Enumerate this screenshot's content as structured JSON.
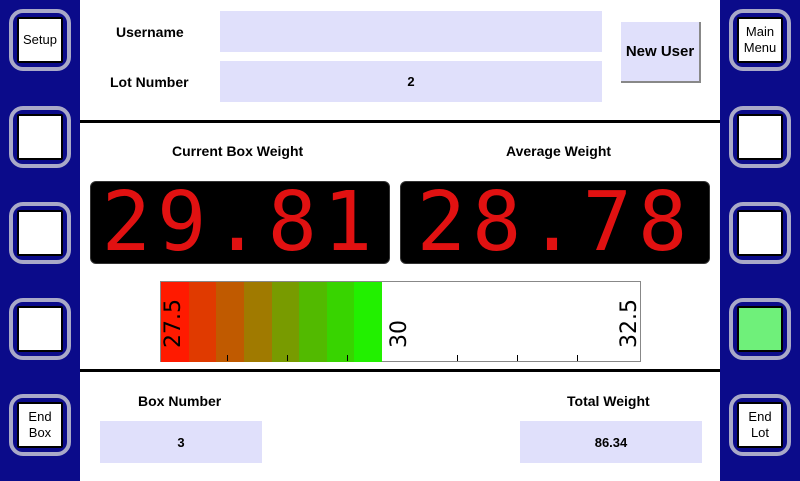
{
  "left_buttons": [
    {
      "label": "Setup"
    },
    {
      "label": ""
    },
    {
      "label": ""
    },
    {
      "label": ""
    },
    {
      "label": "End\nBox"
    }
  ],
  "right_buttons": [
    {
      "label": "Main\nMenu"
    },
    {
      "label": ""
    },
    {
      "label": ""
    },
    {
      "label": "",
      "indicator": "green"
    },
    {
      "label": "End\nLot"
    }
  ],
  "header": {
    "username_label": "Username",
    "username_value": "",
    "lot_label": "Lot Number",
    "lot_value": "2",
    "new_user_button": "New User"
  },
  "weights": {
    "current_label": "Current Box Weight",
    "current_value": "29.81",
    "average_label": "Average Weight",
    "average_value": "28.78",
    "display_color": "#e11111"
  },
  "gauge": {
    "min_label": "27.5",
    "mid_label": "30",
    "max_label": "32.5",
    "min": 27.5,
    "max": 32.5,
    "current": 29.81,
    "fill_colors": [
      "#ff1a00",
      "#e03a00",
      "#c05a00",
      "#a07a00",
      "#789b00",
      "#52ba00",
      "#38d400",
      "#22f000"
    ]
  },
  "footer": {
    "box_number_label": "Box Number",
    "box_number_value": "3",
    "total_weight_label": "Total Weight",
    "total_weight_value": "86.34"
  }
}
